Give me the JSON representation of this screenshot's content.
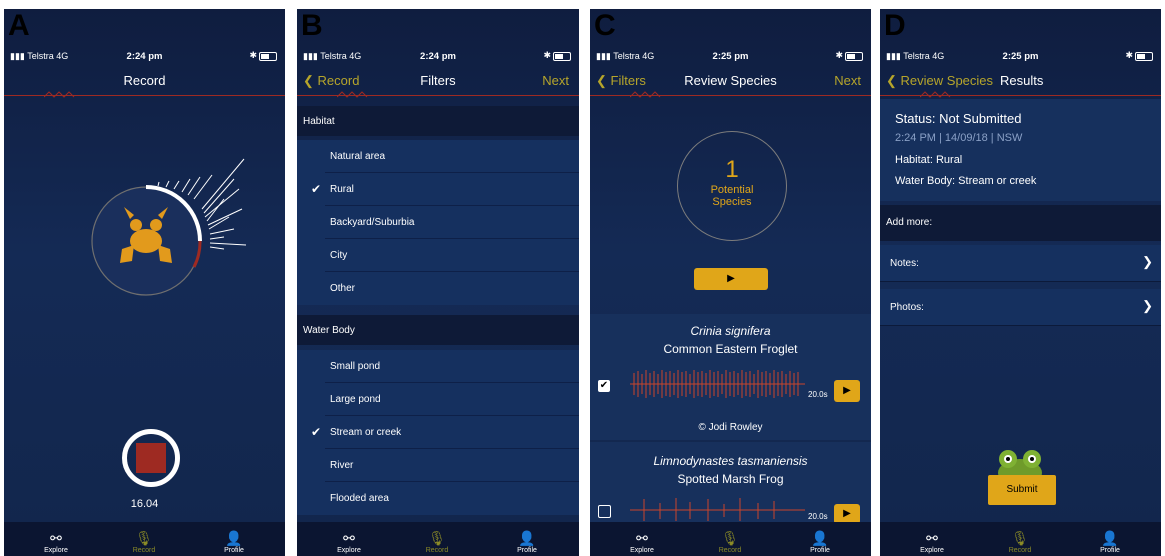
{
  "status": {
    "carrier": "Telstra",
    "network": "4G",
    "time_a": "2:24 pm",
    "time_b": "2:24 pm",
    "time_c": "2:25 pm",
    "time_d": "2:25 pm",
    "bt": "✱"
  },
  "labels": {
    "a": "A",
    "b": "B",
    "c": "C",
    "d": "D"
  },
  "tabs": {
    "explore": "Explore",
    "record": "Record",
    "profile": "Profile"
  },
  "panel_a": {
    "title": "Record",
    "timer": "16.04"
  },
  "panel_b": {
    "back": "Record",
    "title": "Filters",
    "next": "Next",
    "habitat_header": "Habitat",
    "habitat": [
      "Natural area",
      "Rural",
      "Backyard/Suburbia",
      "City",
      "Other"
    ],
    "habitat_checked": "Rural",
    "water_header": "Water Body",
    "water": [
      "Small pond",
      "Large pond",
      "Stream or creek",
      "River",
      "Flooded area"
    ],
    "water_checked": "Stream or creek"
  },
  "panel_c": {
    "back": "Filters",
    "title": "Review Species",
    "next": "Next",
    "potential_count": "1",
    "potential_label_1": "Potential",
    "potential_label_2": "Species",
    "species": [
      {
        "sci": "Crinia signifera",
        "common": "Common Eastern Froglet",
        "duration": "20.0s",
        "credit": "© Jodi Rowley",
        "checked": true
      },
      {
        "sci": "Limnodynastes tasmaniensis",
        "common": "Spotted Marsh Frog",
        "duration": "20.0s",
        "checked": false
      }
    ]
  },
  "panel_d": {
    "back": "Review Species",
    "title": "Results",
    "status": "Status: Not Submitted",
    "datetime": "2:24 PM | 14/09/18 | NSW",
    "habitat": "Habitat: Rural",
    "water": "Water Body: Stream or creek",
    "add_more": "Add more:",
    "notes": "Notes:",
    "photos": "Photos:",
    "submit": "Submit"
  },
  "colors": {
    "accent_yellow": "#e0a619",
    "nav_gold": "#b6a52b",
    "record_red": "#9e2a22",
    "frog_orange": "#e29a1c"
  }
}
